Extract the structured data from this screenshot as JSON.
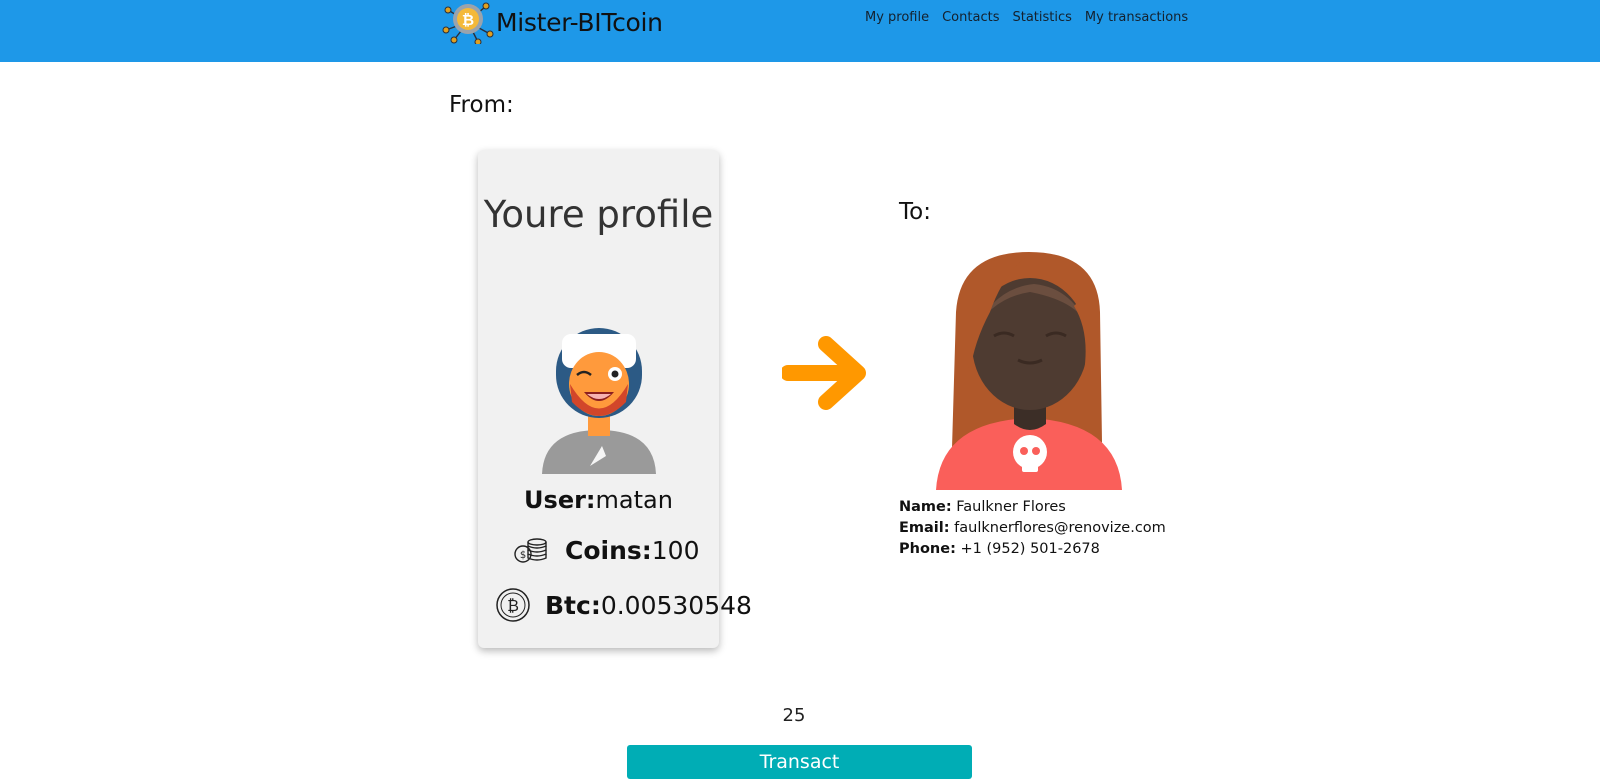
{
  "app": {
    "brand_title": "Mister-BITcoin",
    "nav": [
      "My profile",
      "Contacts",
      "Statistics",
      "My transactions"
    ]
  },
  "colors": {
    "header_bg": "#1e98e8",
    "button_bg": "#00adb5",
    "arrow": "#ff9800",
    "card_bg": "#f1f1f1"
  },
  "transfer": {
    "from_label": "From:",
    "to_label": "To:",
    "profile": {
      "title": "Youre profile",
      "user_label": "User:",
      "user_value": "matan",
      "coins_label": "Coins:",
      "coins_value": "100",
      "btc_label": "Btc:",
      "btc_value": "0.00530548"
    },
    "contact": {
      "name_label": "Name:",
      "name_value": "Faulkner Flores",
      "email_label": "Email:",
      "email_value": "faulknerflores@renovize.com",
      "phone_label": "Phone:",
      "phone_value": "+1 (952) 501-2678"
    },
    "amount": "25",
    "button_label": "Transact"
  },
  "icons": [
    "bitcoin-logo-icon",
    "coins-icon",
    "btc-icon",
    "arrow-right-icon",
    "user-avatar",
    "contact-avatar"
  ]
}
